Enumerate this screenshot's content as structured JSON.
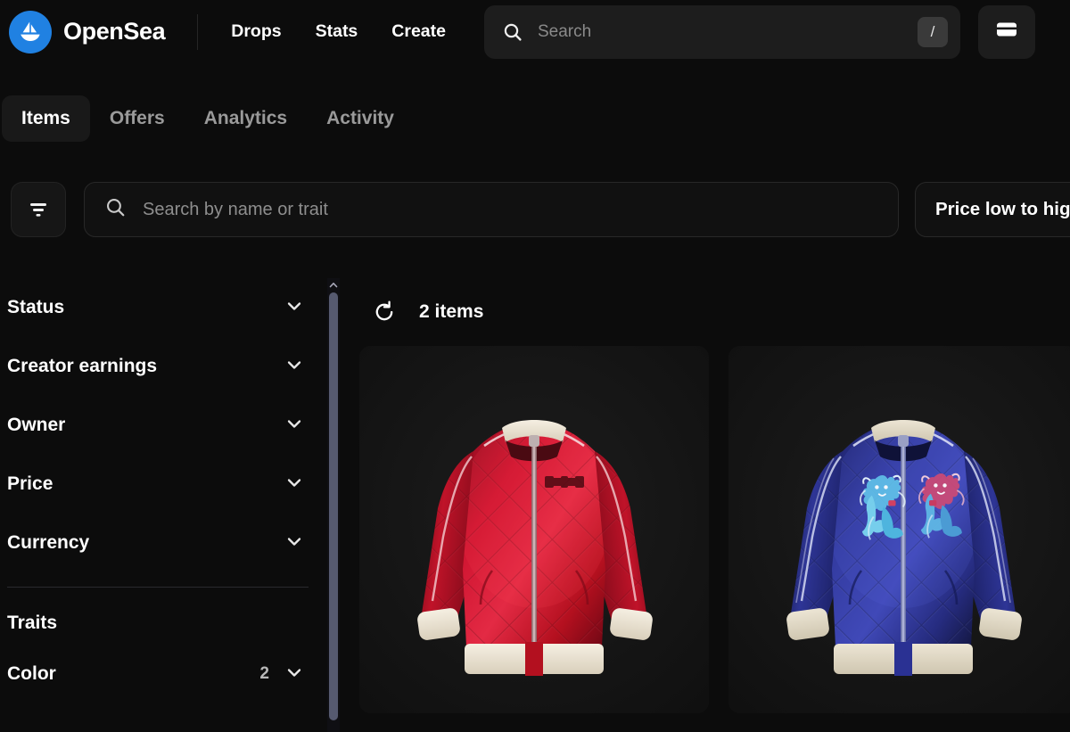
{
  "brand": {
    "name": "OpenSea",
    "logo_icon": "sailboat-icon",
    "logo_color": "#2081e2"
  },
  "topnav": {
    "links": [
      {
        "label": "Drops"
      },
      {
        "label": "Stats"
      },
      {
        "label": "Create"
      }
    ],
    "search": {
      "icon": "search-icon",
      "placeholder": "Search",
      "value": "",
      "shortcut": "/"
    },
    "wallet": {
      "icon": "wallet-icon"
    }
  },
  "tabs": [
    {
      "label": "Items",
      "active": true
    },
    {
      "label": "Offers",
      "active": false
    },
    {
      "label": "Analytics",
      "active": false
    },
    {
      "label": "Activity",
      "active": false
    }
  ],
  "toolbar": {
    "filter_icon": "filter-icon",
    "trait_search": {
      "icon": "search-icon",
      "placeholder": "Search by name or trait",
      "value": ""
    },
    "sort": {
      "label": "Price low to high",
      "icon": "chevron-down-icon"
    }
  },
  "sidebar": {
    "groups": [
      {
        "label": "Status",
        "count": "",
        "icon": "chevron-down-icon"
      },
      {
        "label": "Creator earnings",
        "count": "",
        "icon": "chevron-down-icon"
      },
      {
        "label": "Owner",
        "count": "",
        "icon": "chevron-down-icon"
      },
      {
        "label": "Price",
        "count": "",
        "icon": "chevron-down-icon"
      },
      {
        "label": "Currency",
        "count": "",
        "icon": "chevron-down-icon"
      }
    ],
    "traits_title": "Traits",
    "traits": [
      {
        "label": "Color",
        "count": "2",
        "icon": "chevron-down-icon"
      }
    ],
    "scrollbar": {
      "up_arrow_icon": "chevron-up-icon",
      "thumb_color": "#565a70"
    }
  },
  "main": {
    "refresh_icon": "refresh-icon",
    "items_count_label": "2 items",
    "cards": [
      {
        "name": "red-quilted-bomber-jacket",
        "colors": {
          "body": "#c8122c",
          "body_dark": "#7d0a1c",
          "body_light": "#e8304a",
          "trim": "#efe7d8",
          "logo": "#4a0a13"
        },
        "background": "#161616"
      },
      {
        "name": "blue-souvenir-tiger-jacket",
        "colors": {
          "body": "#2c3392",
          "body_dark": "#171c5c",
          "body_light": "#4a53c4",
          "trim": "#e4ddcc",
          "motif_blue": "#5fc8e8",
          "motif_pink": "#d8436f"
        },
        "background": "#161616"
      }
    ]
  },
  "theme": {
    "page_background": "#0c0c0c",
    "card_background": "#161616",
    "accent": "#2081e2",
    "text_primary": "#ffffff",
    "text_muted": "#9a9a9a"
  }
}
